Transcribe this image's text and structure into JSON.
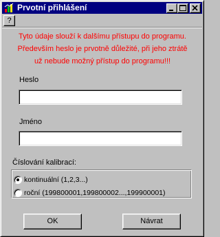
{
  "window": {
    "title": "Prvotní přihlášení",
    "icon": "app-icon",
    "help_label": "?"
  },
  "warning": {
    "line1": "Tyto údaje slouží k dalšímu přístupu do programu.",
    "line2": "Především heslo je prvotně důležité, při jeho ztrátě",
    "line3": "už nebude možný přístup do programu!!!",
    "color": "#ff0000"
  },
  "form": {
    "heslo_label": "Heslo",
    "heslo_value": "",
    "jmeno_label": "Jméno",
    "jmeno_value": ""
  },
  "calibration": {
    "group_label": "Číslování kalibrací:",
    "options": [
      {
        "label": "kontinuální (1,2,3...)",
        "selected": true
      },
      {
        "label": "roční (199800001,199800002...,199900001)",
        "selected": false
      }
    ]
  },
  "buttons": {
    "ok_label": "OK",
    "navrat_label": "Návrat"
  },
  "colors": {
    "face": "#c0c0c0",
    "titlebar": "#000080"
  }
}
